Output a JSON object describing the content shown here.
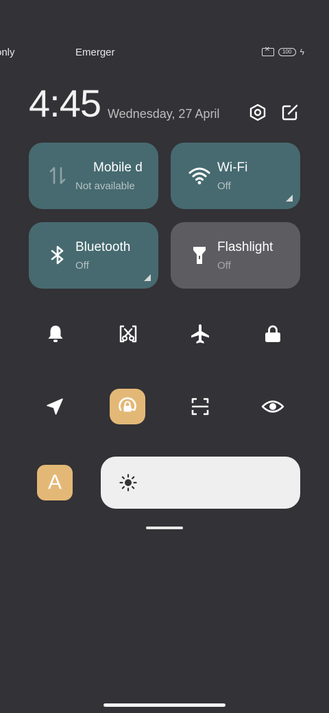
{
  "status_bar": {
    "carrier_1": "only",
    "carrier_2": "Emerger",
    "battery_level": "100",
    "icons": [
      "no-sim-icon",
      "battery-icon",
      "charging-bolt-icon"
    ]
  },
  "header": {
    "time": "4:45",
    "date": "Wednesday, 27 April",
    "icons": [
      "settings-icon",
      "edit-icon"
    ]
  },
  "tiles": [
    {
      "label": "Mobile d",
      "status": "Not available",
      "icon": "mobile-data-icon",
      "color": "#466a70"
    },
    {
      "label": "Wi-Fi",
      "status": "Off",
      "icon": "wifi-icon",
      "color": "#466a70"
    },
    {
      "label": "Bluetooth",
      "status": "Off",
      "icon": "bluetooth-icon",
      "color": "#466a70"
    },
    {
      "label": "Flashlight",
      "status": "Off",
      "icon": "flashlight-icon",
      "color": "#5d5c61"
    }
  ],
  "toggles_row_1": [
    "bell-icon",
    "screenshot-icon",
    "airplane-icon",
    "lock-icon"
  ],
  "toggles_row_2": [
    "location-icon",
    "rotation-lock-icon",
    "scanner-icon",
    "eye-icon"
  ],
  "active_color": "#e3b877",
  "brightness": {
    "auto_label": "A",
    "icon": "sun-icon",
    "level": 1.0
  }
}
